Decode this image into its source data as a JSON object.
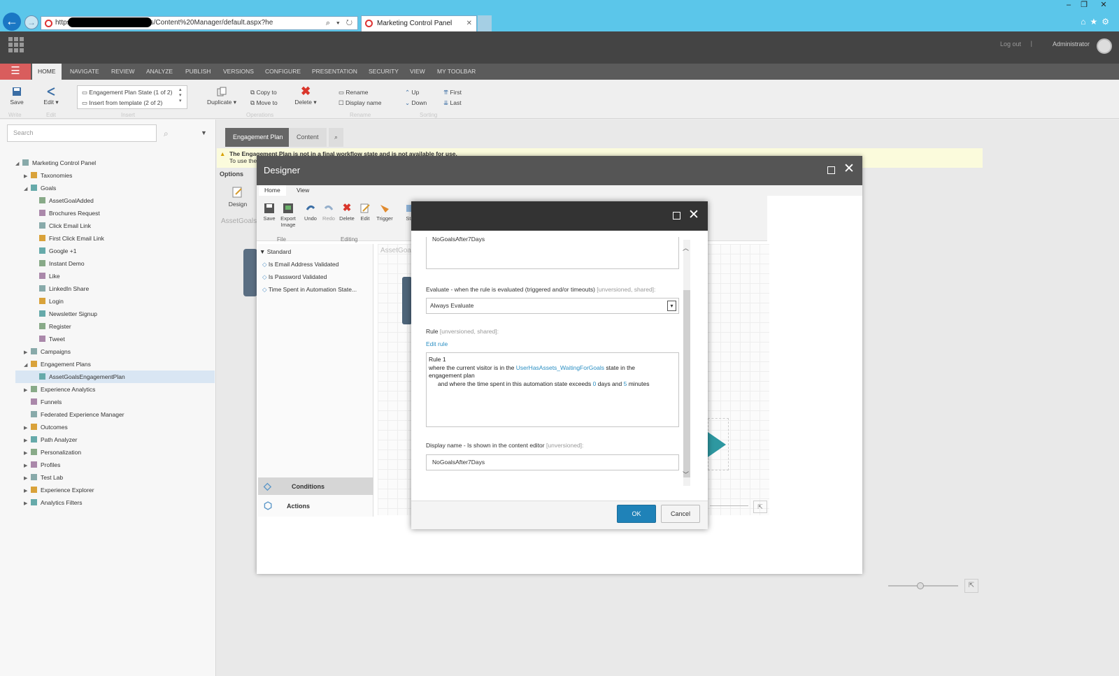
{
  "browser": {
    "url": "https://              tecore/shell/Applications/Content%20Manager/default.aspx?he",
    "tab_title": "Marketing Control Panel",
    "win_min": "–",
    "win_restore": "❐",
    "win_close": "✕"
  },
  "topbar": {
    "logout": "Log out",
    "separator": "|",
    "user": "Administrator"
  },
  "ribbon": {
    "tabs": [
      "HOME",
      "NAVIGATE",
      "REVIEW",
      "ANALYZE",
      "PUBLISH",
      "VERSIONS",
      "CONFIGURE",
      "PRESENTATION",
      "SECURITY",
      "VIEW",
      "MY TOOLBAR"
    ],
    "save": "Save",
    "edit": "Edit",
    "insert_1": "Engagement Plan State (1 of 2)",
    "insert_2": "Insert from template    (2 of 2)",
    "duplicate": "Duplicate",
    "copy_to": "Copy to",
    "move_to": "Move to",
    "delete": "Delete",
    "rename": "Rename",
    "display_name": "Display name",
    "up": "Up",
    "down": "Down",
    "first": "First",
    "last": "Last",
    "groups": [
      "Write",
      "Edit",
      "Insert",
      "Operations",
      "Rename",
      "Sorting"
    ]
  },
  "search": {
    "placeholder": "Search"
  },
  "tree": [
    {
      "label": "Marketing Control Panel",
      "level": 0,
      "toggle": "◢"
    },
    {
      "label": "Taxonomies",
      "level": 1,
      "toggle": "▶"
    },
    {
      "label": "Goals",
      "level": 1,
      "toggle": "◢"
    },
    {
      "label": "AssetGoalAdded",
      "level": 2,
      "toggle": ""
    },
    {
      "label": "Brochures Request",
      "level": 2,
      "toggle": ""
    },
    {
      "label": "Click Email Link",
      "level": 2,
      "toggle": ""
    },
    {
      "label": "First Click Email Link",
      "level": 2,
      "toggle": ""
    },
    {
      "label": "Google +1",
      "level": 2,
      "toggle": ""
    },
    {
      "label": "Instant Demo",
      "level": 2,
      "toggle": ""
    },
    {
      "label": "Like",
      "level": 2,
      "toggle": ""
    },
    {
      "label": "LinkedIn Share",
      "level": 2,
      "toggle": ""
    },
    {
      "label": "Login",
      "level": 2,
      "toggle": ""
    },
    {
      "label": "Newsletter Signup",
      "level": 2,
      "toggle": ""
    },
    {
      "label": "Register",
      "level": 2,
      "toggle": ""
    },
    {
      "label": "Tweet",
      "level": 2,
      "toggle": ""
    },
    {
      "label": "Campaigns",
      "level": 1,
      "toggle": "▶"
    },
    {
      "label": "Engagement Plans",
      "level": 1,
      "toggle": "◢"
    },
    {
      "label": "AssetGoalsEngagementPlan",
      "level": 2,
      "toggle": "",
      "selected": true
    },
    {
      "label": "Experience Analytics",
      "level": 1,
      "toggle": "▶"
    },
    {
      "label": "Funnels",
      "level": 1,
      "toggle": ""
    },
    {
      "label": "Federated Experience Manager",
      "level": 1,
      "toggle": ""
    },
    {
      "label": "Outcomes",
      "level": 1,
      "toggle": "▶"
    },
    {
      "label": "Path Analyzer",
      "level": 1,
      "toggle": "▶"
    },
    {
      "label": "Personalization",
      "level": 1,
      "toggle": "▶"
    },
    {
      "label": "Profiles",
      "level": 1,
      "toggle": "▶"
    },
    {
      "label": "Test Lab",
      "level": 1,
      "toggle": "▶"
    },
    {
      "label": "Experience Explorer",
      "level": 1,
      "toggle": "▶"
    },
    {
      "label": "Analytics Filters",
      "level": 1,
      "toggle": "▶"
    }
  ],
  "content": {
    "tab_engagement": "Engagement Plan",
    "tab_content": "Content",
    "warning_1": "The Engagement Plan is not in a final workflow state and is not available for use.",
    "warning_2": "To use the",
    "options": "Options",
    "design": "Design",
    "asset_label": "AssetGoals"
  },
  "designer": {
    "title": "Designer",
    "tab_home": "Home",
    "tab_view": "View",
    "tools": [
      "Save",
      "Export Image",
      "Undo",
      "Redo",
      "Delete",
      "Edit",
      "Trigger",
      "Sta"
    ],
    "group_file": "File",
    "group_editing": "Editing",
    "section_standard": "Standard",
    "conditions": [
      "Is Email Address Validated",
      "Is Password Validated",
      "Time Spent in Automation State..."
    ],
    "canvas_label": "AssetGoa",
    "conditions_label": "Conditions",
    "actions_label": "Actions"
  },
  "modal": {
    "top_field_value": "NoGoalsAfter7Days",
    "evaluate_label": "Evaluate - when the rule is evaluated (triggered and/or timeouts)",
    "evaluate_meta": "[unversioned, shared]:",
    "evaluate_value": "Always Evaluate",
    "rule_label": "Rule",
    "rule_meta": "[unversioned, shared]:",
    "edit_rule": "Edit rule",
    "rule_title": "Rule 1",
    "rule_line1_a": "where the current visitor is in the",
    "rule_state": "UserHasAssets_WaitingForGoals",
    "rule_line1_b": "state in the",
    "rule_line2": "engagement plan",
    "rule_line3_a": "and where the time spent in this automation state exceeds",
    "rule_days": "0",
    "rule_line3_b": "days and",
    "rule_minutes": "5",
    "rule_line3_c": "minutes",
    "display_label": "Display name - Is shown in the content editor",
    "display_meta": "[unversioned]:",
    "display_value": "NoGoalsAfter7Days",
    "ok": "OK",
    "cancel": "Cancel"
  }
}
